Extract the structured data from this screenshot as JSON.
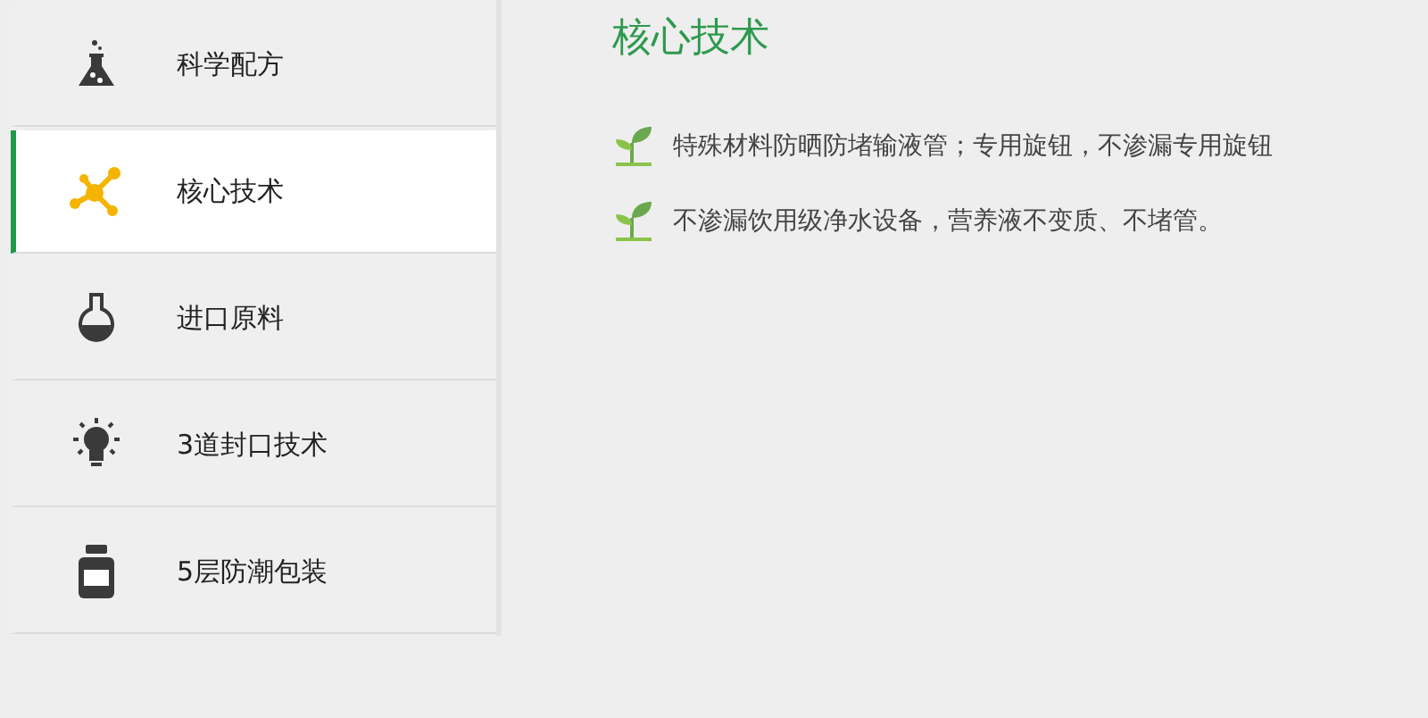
{
  "sidebar": {
    "items": [
      {
        "label": "科学配方",
        "kind": "flask",
        "selected": false
      },
      {
        "label": "核心技术",
        "kind": "molecule",
        "selected": true
      },
      {
        "label": "进口原料",
        "kind": "beaker",
        "selected": false
      },
      {
        "label": "3道封口技术",
        "kind": "bulb",
        "selected": false
      },
      {
        "label": "5层防潮包装",
        "kind": "bottle",
        "selected": false
      }
    ]
  },
  "content": {
    "title": "核心技术",
    "points": [
      "特殊材料防晒防堵输液管；专用旋钮，不渗漏专用旋钮",
      "不渗漏饮用级净水设备，营养液不变质、不堵管。"
    ]
  }
}
